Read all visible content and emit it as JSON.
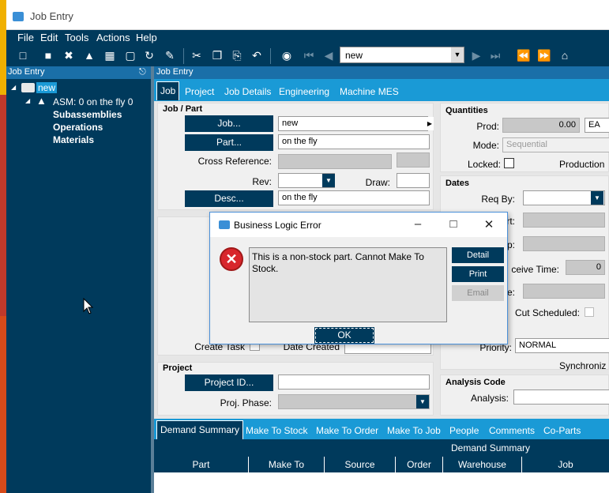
{
  "window": {
    "title": "Job Entry"
  },
  "menu": [
    "File",
    "Edit",
    "Tools",
    "Actions",
    "Help"
  ],
  "toolbar": {
    "record_value": "new"
  },
  "tree": {
    "header": "Job Entry",
    "root": "new",
    "asm": "ASM: 0 on the fly 0",
    "children": [
      "Subassemblies",
      "Operations",
      "Materials"
    ]
  },
  "panel": {
    "header": "Job Entry"
  },
  "tabs": [
    "Job",
    "Project",
    "Job Details",
    "Engineering",
    "Machine MES"
  ],
  "job_part": {
    "group_label": "Job / Part",
    "job_button": "Job...",
    "job_value": "new",
    "part_button": "Part...",
    "part_value": "on the fly",
    "cross_ref_label": "Cross Reference:",
    "rev_label": "Rev:",
    "draw_label": "Draw:",
    "desc_button": "Desc...",
    "desc_value": "on the fly"
  },
  "quantities": {
    "group_label": "Quantities",
    "prod_label": "Prod:",
    "prod_value": "0.00",
    "uom": "EA",
    "mode_label": "Mode:",
    "mode_value": "Sequential",
    "locked_label": "Locked:",
    "production_label": "Production"
  },
  "dates": {
    "group_label": "Dates",
    "req_by_label": "Req By:",
    "start_label_partial": "rt:",
    "due_label_partial": "p:",
    "receive_time_label": "ceive Time:",
    "receive_time_value": "0",
    "date_label_partial": "e:",
    "cut_scheduled_label": "Cut Scheduled:",
    "priority_label": "Priority:",
    "priority_value": "NORMAL",
    "synchronize_label": "Synchroniz"
  },
  "middle": {
    "create_task_label": "Create Task",
    "date_created_label": "Date Created"
  },
  "project": {
    "group_label": "Project",
    "project_id_button": "Project ID...",
    "proj_phase_label": "Proj. Phase:"
  },
  "analysis": {
    "group_label": "Analysis Code",
    "analysis_label": "Analysis:"
  },
  "bottom_tabs": [
    "Demand Summary",
    "Make To Stock",
    "Make To Order",
    "Make To Job",
    "People",
    "Comments",
    "Co-Parts"
  ],
  "demand_summary": {
    "title": "Demand Summary",
    "columns": [
      "Part",
      "Make To",
      "Source",
      "Order",
      "Warehouse",
      "Job"
    ]
  },
  "dialog": {
    "title": "Business Logic Error",
    "message": "This is a non-stock part.  Cannot Make To Stock.",
    "detail_button": "Detail",
    "print_button": "Print",
    "email_button": "Email",
    "ok_button": "OK"
  }
}
